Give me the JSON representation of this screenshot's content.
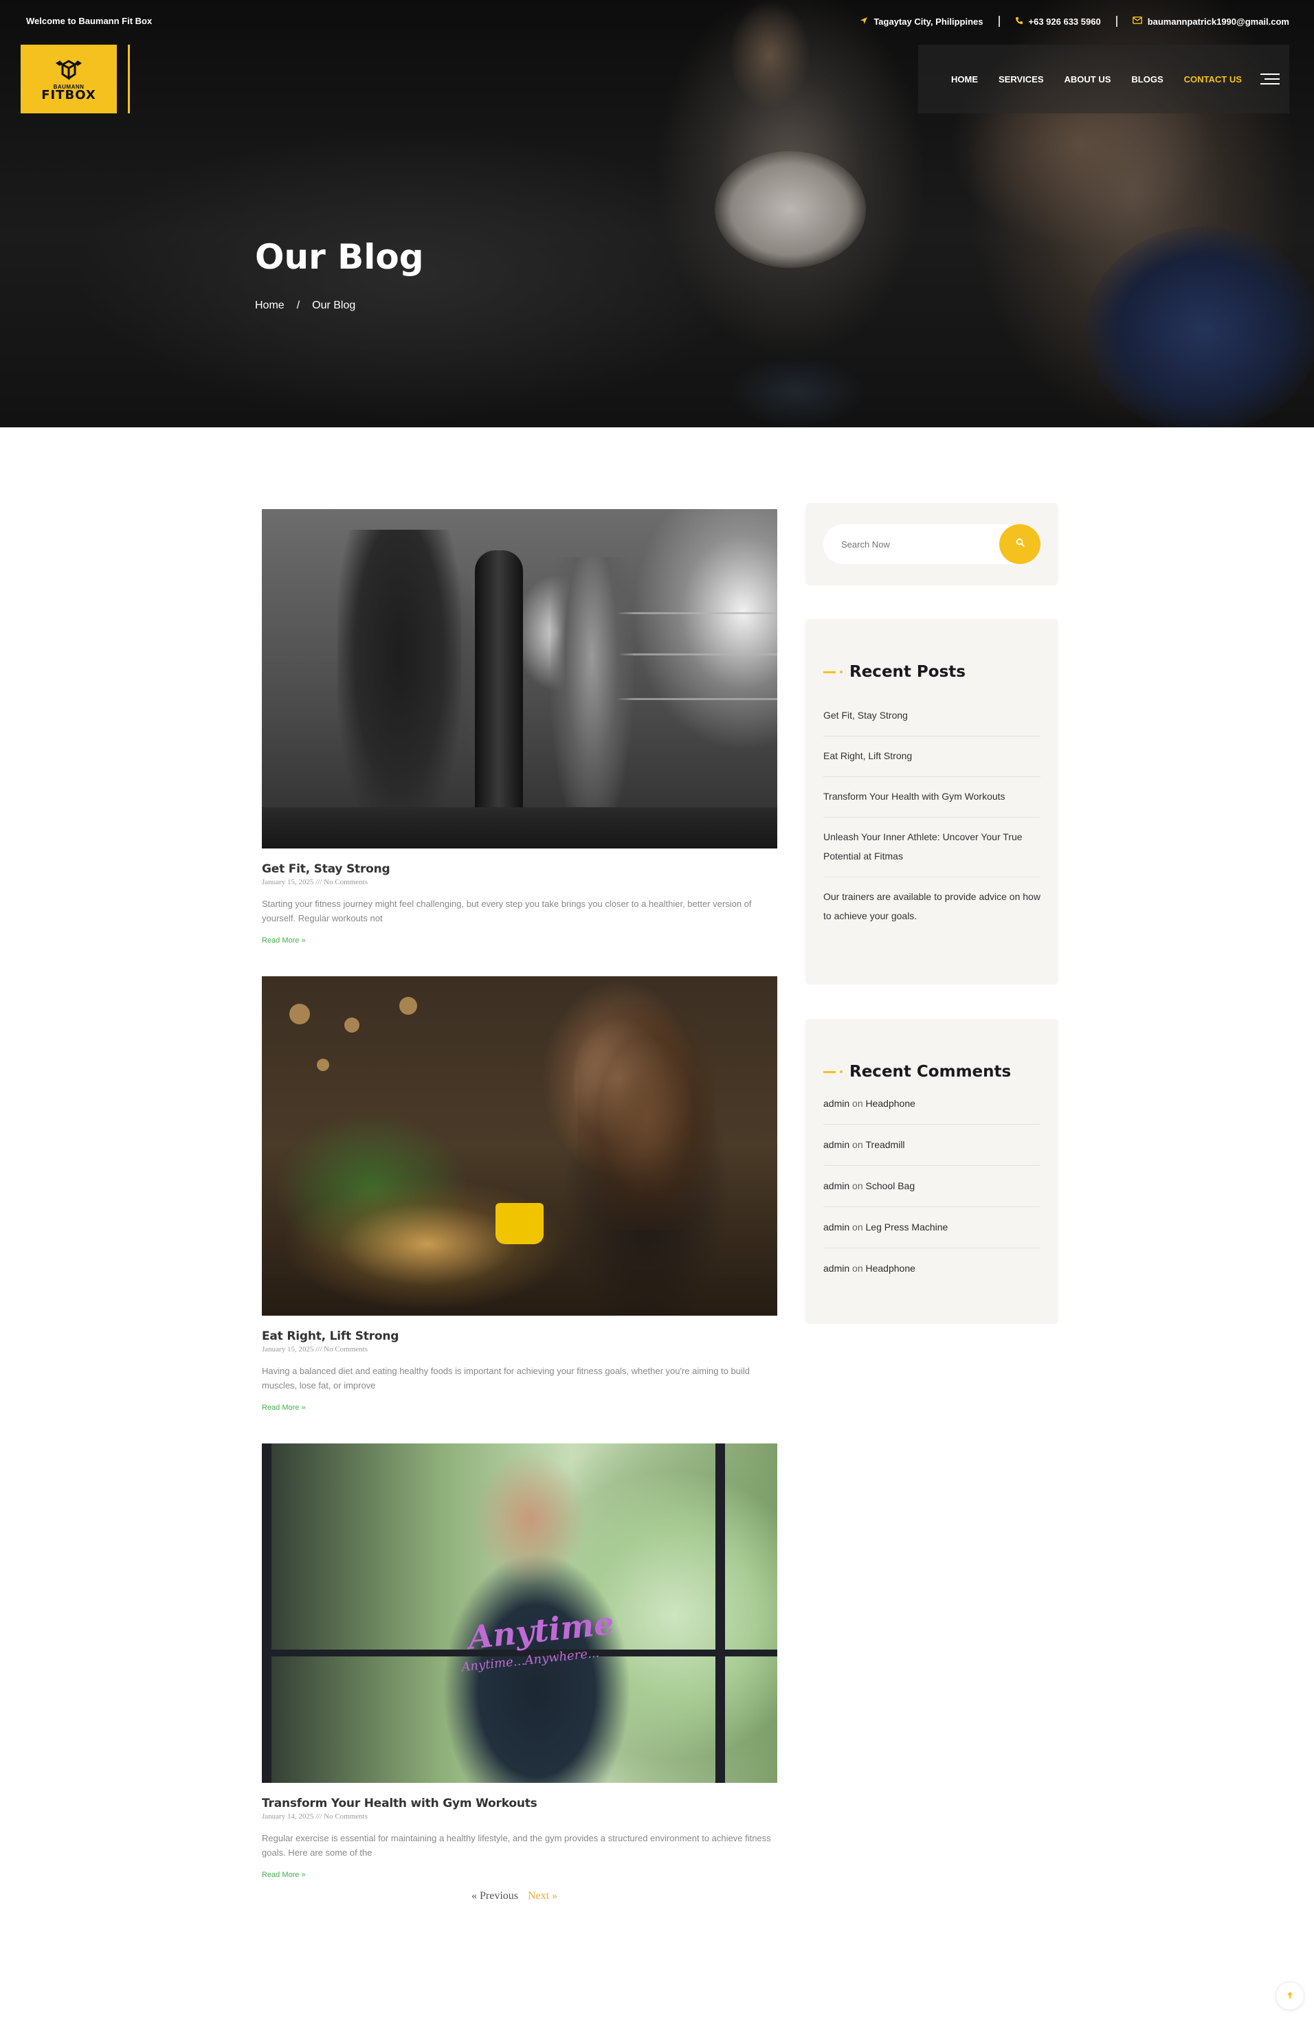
{
  "topbar": {
    "welcome": "Welcome to Baumann Fit Box",
    "location": "Tagaytay City, Philippines",
    "phone": "+63 926 633 5960",
    "email": "baumannpatrick1990@gmail.com"
  },
  "logo": {
    "small_text": "BAUMANN",
    "text": "FITBOX"
  },
  "nav": {
    "items": [
      "HOME",
      "SERVICES",
      "ABOUT US",
      "BLOGS",
      "CONTACT US"
    ],
    "active": "CONTACT US"
  },
  "hero": {
    "title": "Our Blog",
    "breadcrumb": [
      "Home",
      "/",
      "Our Blog"
    ]
  },
  "posts": [
    {
      "title": "Get Fit, Stay Strong",
      "meta": "January 15, 2025 /// No Comments",
      "excerpt": "Starting your fitness journey might feel challenging, but every step you take brings you closer to a healthier, better version of yourself. Regular workouts not",
      "read_more": "Read More »"
    },
    {
      "title": "Eat Right, Lift Strong",
      "meta": "January 15, 2025 /// No Comments",
      "excerpt": "Having a balanced diet and eating healthy foods is important for achieving your fitness goals, whether you're aiming to build muscles, lose fat, or improve",
      "read_more": "Read More »"
    },
    {
      "title": "Transform Your Health with Gym Workouts",
      "meta": "January 14, 2025 /// No Comments",
      "excerpt": "Regular exercise is essential for maintaining a healthy lifestyle, and the gym provides a structured environment to achieve fitness goals. Here are some of the",
      "read_more": "Read More »",
      "image_text": "Anytime",
      "image_subtext": "Anytime...Anywhere..."
    }
  ],
  "pagination": {
    "prev": "« Previous",
    "next": "Next »"
  },
  "sidebar": {
    "search_placeholder": "Search Now",
    "recent_posts_title": "Recent Posts",
    "recent_posts": [
      "Get Fit, Stay Strong",
      "Eat Right, Lift Strong",
      "Transform Your Health with Gym Workouts",
      "Unleash Your Inner Athlete: Uncover Your True Potential at Fitmas",
      "Our trainers are available to provide advice on how to achieve your goals."
    ],
    "recent_comments_title": "Recent Comments",
    "recent_comments": [
      {
        "author": "admin",
        "on": "on",
        "target": "Headphone"
      },
      {
        "author": "admin",
        "on": "on",
        "target": "Treadmill"
      },
      {
        "author": "admin",
        "on": "on",
        "target": "School Bag"
      },
      {
        "author": "admin",
        "on": "on",
        "target": "Leg Press Machine"
      },
      {
        "author": "admin",
        "on": "on",
        "target": "Headphone"
      }
    ]
  },
  "icons": {
    "location": "location-arrow-icon",
    "phone": "phone-icon",
    "email": "envelope-icon",
    "search": "search-icon",
    "menu": "hamburger-menu-icon",
    "scroll_top": "arrow-up-icon"
  },
  "colors": {
    "accent": "#f5c11f",
    "read_more": "#44b04a",
    "next_link": "#e8a93a",
    "widget_bg": "#f7f5f2",
    "hero_bg": "#121212"
  }
}
